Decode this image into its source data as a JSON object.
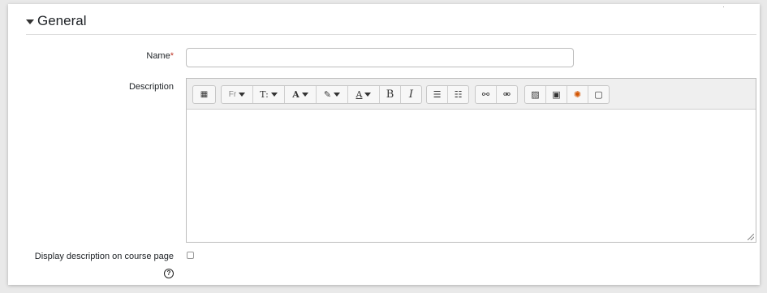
{
  "section": {
    "title": "General"
  },
  "fields": {
    "name": {
      "label": "Name",
      "required_mark": "*",
      "value": ""
    },
    "description": {
      "label": "Description",
      "value": ""
    },
    "display_description": {
      "label": "Display description on course page",
      "checked": false,
      "help": "?"
    }
  },
  "toolbar": {
    "buttons": [
      {
        "name": "show-more-icon",
        "glyph": "▦"
      },
      {
        "name": "font-family-icon",
        "glyph": "Fr"
      },
      {
        "name": "font-size-icon",
        "glyph": "T:"
      },
      {
        "name": "font-color-icon",
        "glyph": "A"
      },
      {
        "name": "background-color-icon",
        "glyph": "✎"
      },
      {
        "name": "style-icon",
        "glyph": "A"
      },
      {
        "name": "bold-icon",
        "glyph": "B"
      },
      {
        "name": "italic-icon",
        "glyph": "I"
      },
      {
        "name": "unordered-list-icon",
        "glyph": "☰"
      },
      {
        "name": "ordered-list-icon",
        "glyph": "☰"
      },
      {
        "name": "link-icon",
        "glyph": "🔗"
      },
      {
        "name": "unlink-icon",
        "glyph": "⛓"
      },
      {
        "name": "image-icon",
        "glyph": "🖼"
      },
      {
        "name": "media-icon",
        "glyph": "▣"
      },
      {
        "name": "h5p-icon",
        "glyph": "✺"
      },
      {
        "name": "file-manager-icon",
        "glyph": "▢"
      }
    ]
  }
}
